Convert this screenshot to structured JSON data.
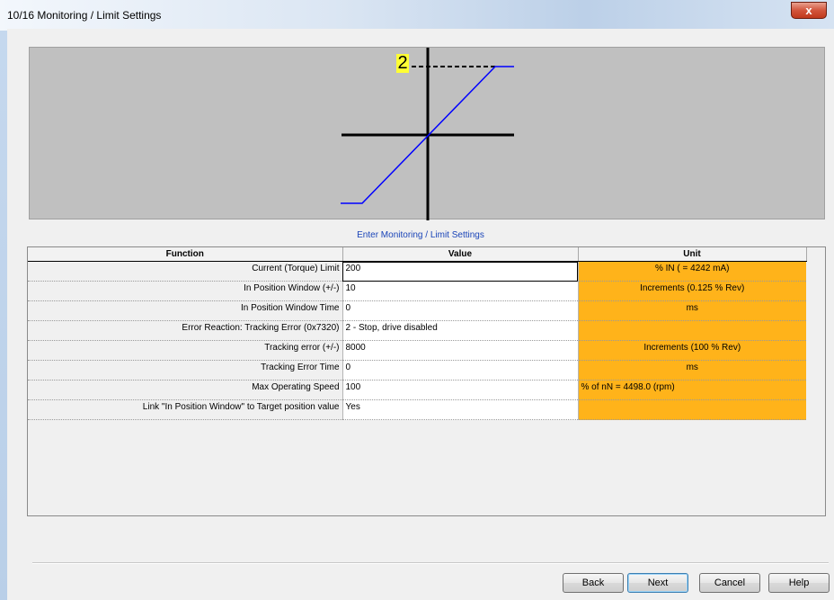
{
  "window": {
    "title": "10/16 Monitoring / Limit Settings",
    "close_glyph": "x"
  },
  "graph": {
    "limit_value": "2",
    "line_color": "#0000ff"
  },
  "header_text": "Enter Monitoring / Limit Settings",
  "table": {
    "columns": [
      "Function",
      "Value",
      "Unit"
    ],
    "rows": [
      {
        "function": "Current (Torque) Limit",
        "value": "200",
        "unit": "% IN ( = 4242 mA)"
      },
      {
        "function": "In Position Window  (+/-)",
        "value": "10",
        "unit": "Increments (0.125 % Rev)"
      },
      {
        "function": "In Position Window Time",
        "value": "0",
        "unit": "ms"
      },
      {
        "function": "Error Reaction: Tracking Error (0x7320)",
        "value": "2 - Stop, drive disabled",
        "unit": ""
      },
      {
        "function": "Tracking error  (+/-)",
        "value": "8000",
        "unit": "Increments (100 % Rev)"
      },
      {
        "function": "Tracking Error Time",
        "value": "0",
        "unit": "ms"
      },
      {
        "function": "Max Operating Speed",
        "value": "100",
        "unit": "% of nN = 4498.0 (rpm)"
      },
      {
        "function": "Link \"In Position Window\" to Target position value",
        "value": "Yes",
        "unit": ""
      }
    ]
  },
  "buttons": {
    "back": "Back",
    "next": "Next",
    "cancel": "Cancel",
    "help": "Help"
  },
  "colors": {
    "unit_highlight": "#ffb31a",
    "limit_badge": "#ffff33"
  }
}
